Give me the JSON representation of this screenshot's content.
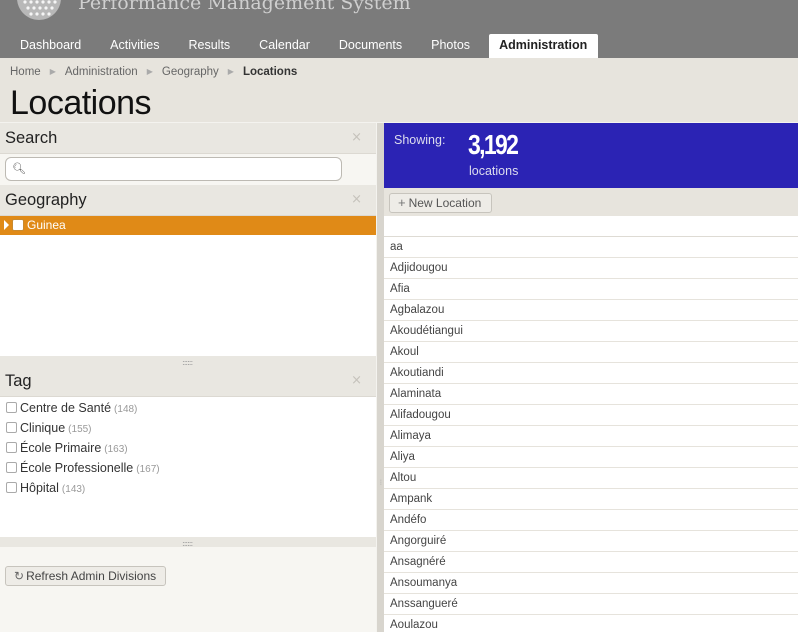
{
  "app": {
    "title": "Performance Management System"
  },
  "nav": {
    "tabs": [
      {
        "label": "Dashboard"
      },
      {
        "label": "Activities"
      },
      {
        "label": "Results"
      },
      {
        "label": "Calendar"
      },
      {
        "label": "Documents"
      },
      {
        "label": "Photos"
      },
      {
        "label": "Administration",
        "active": true
      }
    ]
  },
  "breadcrumb": {
    "items": [
      "Home",
      "Administration",
      "Geography"
    ],
    "current": "Locations"
  },
  "page": {
    "title": "Locations"
  },
  "panels": {
    "search": {
      "title": "Search",
      "close": "×",
      "placeholder": ""
    },
    "geography": {
      "title": "Geography",
      "close": "×",
      "selected": "Guinea"
    },
    "tag": {
      "title": "Tag",
      "close": "×",
      "items": [
        {
          "label": "Centre de Santé",
          "count": "(148)"
        },
        {
          "label": "Clinique",
          "count": "(155)"
        },
        {
          "label": "École Primaire",
          "count": "(163)"
        },
        {
          "label": "École Professionelle",
          "count": "(167)"
        },
        {
          "label": "Hôpital",
          "count": "(143)"
        }
      ]
    },
    "refresh_label": "Refresh Admin Divisions"
  },
  "summary": {
    "showing_label": "Showing:",
    "count": "3,192",
    "unit": "locations"
  },
  "toolbar": {
    "new_label": "New Location"
  },
  "locations": [
    "aa",
    "Adjidougou",
    "Afia",
    "Agbalazou",
    "Akoudétiangui",
    "Akoul",
    "Akoutiandi",
    "Alaminata",
    "Alifadougou",
    "Alimaya",
    "Aliya",
    "Altou",
    "Ampank",
    "Andéfo",
    "Angorguiré",
    "Ansagnéré",
    "Ansoumanya",
    "Anssangueré",
    "Aoulazou"
  ],
  "colors": {
    "header_bg": "#7b7b7b",
    "selected_row": "#e08a17",
    "summary_bg": "#2b23b4"
  }
}
